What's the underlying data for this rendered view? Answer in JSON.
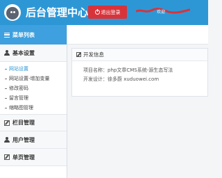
{
  "header": {
    "title": "后台管理中心",
    "logout_label": "退出登录",
    "welcome": "欢迎"
  },
  "sidebar": {
    "menu_title": "菜单列表",
    "groups": [
      {
        "label": "基本设置",
        "items": [
          {
            "label": "网站设置",
            "active": true
          },
          {
            "label": "网站设置-增加变量",
            "active": false
          },
          {
            "label": "修改密码",
            "active": false
          },
          {
            "label": "留言管理",
            "active": false
          },
          {
            "label": "缩略图管理",
            "active": false
          }
        ]
      },
      {
        "label": "栏目管理"
      },
      {
        "label": "用户管理"
      },
      {
        "label": "单页管理"
      }
    ]
  },
  "panel": {
    "title": "开发信息",
    "project_line": "项目名称：php文章CMS系统-源生态写法",
    "developer_line": "开发设计：徐多蔚    xuduowei.com"
  },
  "colors": {
    "header": "#2d97d6",
    "menu_head": "#3ea0de",
    "logout": "#d9333a",
    "active": "#2d97d6"
  }
}
